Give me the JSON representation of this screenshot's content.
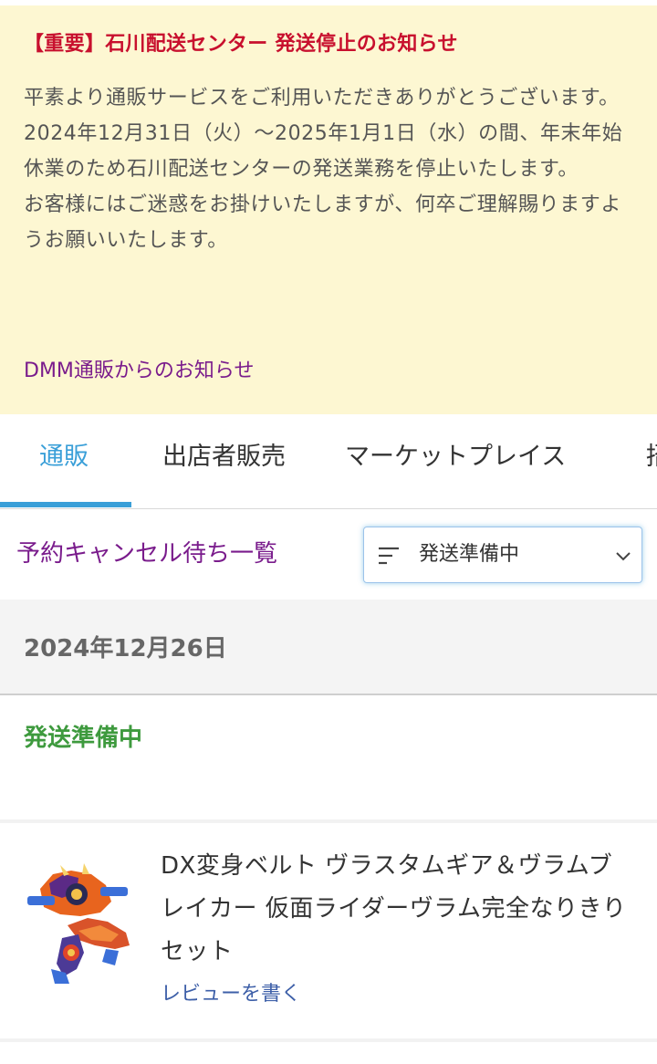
{
  "notice": {
    "title": "【重要】石川配送センター 発送停止のお知らせ",
    "body": "平素より通販サービスをご利用いただきありがとうございます。\n2024年12月31日（火）〜2025年1月1日（水）の間、年末年始休業のため石川配送センターの発送業務を停止いたします。\nお客様にはご迷惑をお掛けいたしますが、何卒ご理解賜りますようお願いいたします。",
    "link_label": "DMM通販からのお知らせ"
  },
  "tabs": [
    {
      "label": "通販",
      "active": true
    },
    {
      "label": "出店者販売",
      "active": false
    },
    {
      "label": "マーケットプレイス",
      "active": false
    },
    {
      "label": "招",
      "active": false
    }
  ],
  "filter": {
    "cancel_link": "予約キャンセル待ち一覧",
    "selected_status": "発送準備中",
    "icon": "filter-lines-icon"
  },
  "order": {
    "date": "2024年12月26日",
    "status": "発送準備中",
    "item_title": "DX変身ベルト ヴラスタムギア＆ヴラムブレイカー 仮面ライダーヴラム完全なりきりセット",
    "review_link": "レビューを書く"
  },
  "colors": {
    "notice_bg": "#fdf7d2",
    "notice_title": "#c8102e",
    "link_purple": "#7a1c8c",
    "tab_active": "#3a9fd8",
    "status_green": "#3e9a3e",
    "review_blue": "#3d5fa8"
  }
}
